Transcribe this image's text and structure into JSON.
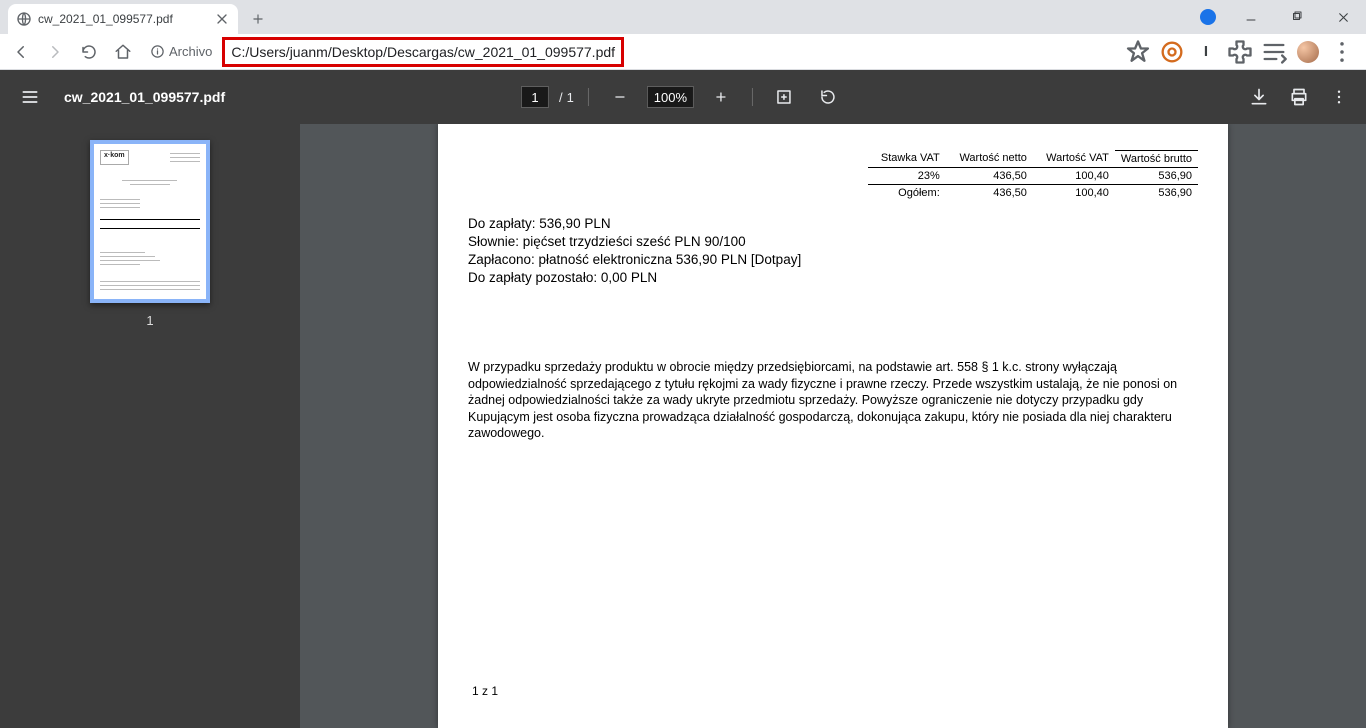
{
  "browser": {
    "tab_title": "cw_2021_01_099577.pdf",
    "archivo_label": "Archivo",
    "url_highlight": "C:/Users/juanm/Desktop/Descargas/cw_2021_01_099577.pdf",
    "letter_icon": "I"
  },
  "pdfbar": {
    "title": "cw_2021_01_099577.pdf",
    "page_current": "1",
    "page_sep": "/",
    "page_total": "1",
    "zoom_value": "100%"
  },
  "thumbnails": {
    "page1_num": "1",
    "thumb_logo": "x·kom"
  },
  "totals": {
    "h_stawka": "Stawka VAT",
    "h_netto": "Wartość netto",
    "h_vat": "Wartość VAT",
    "h_brutto": "Wartość brutto",
    "r1_stawka": "23%",
    "r1_netto": "436,50",
    "r1_vat": "100,40",
    "r1_brutto": "536,90",
    "r2_label": "Ogółem:",
    "r2_netto": "436,50",
    "r2_vat": "100,40",
    "r2_brutto": "536,90"
  },
  "pay": {
    "l1": "Do zapłaty: 536,90 PLN",
    "l2": "Słownie: pięćset trzydzieści sześć PLN 90/100",
    "l3": "Zapłacono: płatność elektroniczna 536,90 PLN [Dotpay]",
    "l4": "Do zapłaty pozostało: 0,00 PLN"
  },
  "legal": "W przypadku sprzedaży produktu w obrocie między przedsiębiorcami, na podstawie art. 558 § 1 k.c. strony wyłączają odpowiedzialność sprzedającego z tytułu rękojmi za wady fizyczne i prawne rzeczy. Przede wszystkim ustalają, że nie ponosi on żadnej odpowiedzialności także za wady ukryte przedmiotu sprzedaży. Powyższe ograniczenie nie dotyczy przypadku gdy Kupującym jest osoba fizyczna prowadząca działalność gospodarczą, dokonująca zakupu, który nie posiada dla niej charakteru zawodowego.",
  "page_footer": "1 z 1"
}
